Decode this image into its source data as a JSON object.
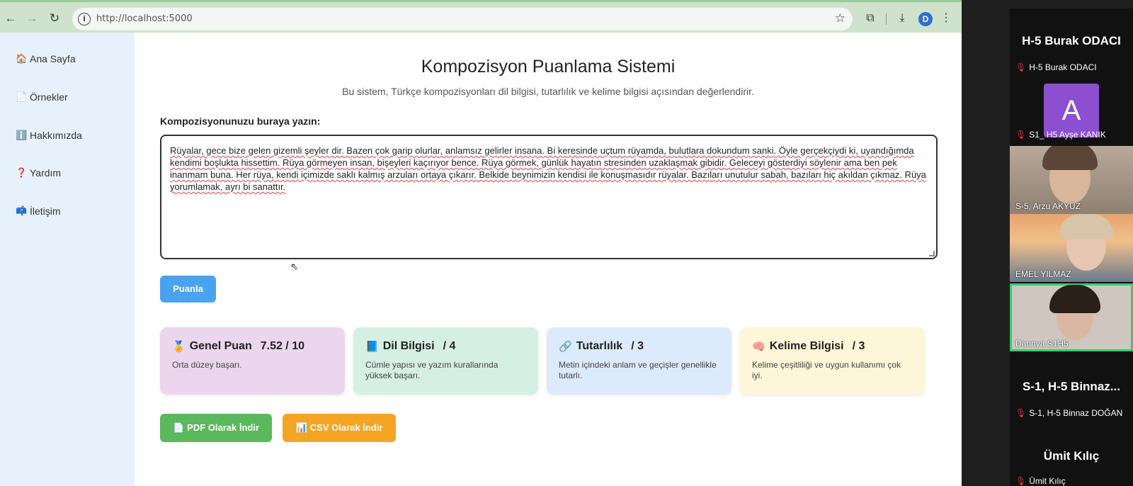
{
  "browser": {
    "url": "http://localhost:5000",
    "profile_initial": "D"
  },
  "sidebar": {
    "items": [
      {
        "icon": "🏠",
        "label": "Ana Sayfa"
      },
      {
        "icon": "📄",
        "label": "Örnekler"
      },
      {
        "icon": "ℹ️",
        "label": "Hakkımızda"
      },
      {
        "icon": "❓",
        "label": "Yardım"
      },
      {
        "icon": "📫",
        "label": "İletişim"
      }
    ]
  },
  "main": {
    "title": "Kompozisyon Puanlama Sistemi",
    "subtitle": "Bu sistem, Türkçe kompozisyonları dil bilgisi, tutarlılık ve kelime bilgisi açısından değerlendirir.",
    "form_label": "Kompozisyonunuzu buraya yazın:",
    "essay": "Rüyalar, gece bize gelen gizemli şeyler dir. Bazen çok garip olurlar, anlamsız gelirler insana. Bi keresinde uçtum rüyamda, bulutlara dokundum sanki. Öyle gerçekçiydi ki, uyandığımda kendimi boşlukta hissettim. Rüya görmeyen insan, bişeyleri kaçırıyor bence. Rüya görmek, günlük hayatın stresinden uzaklaşmak gibidir. Geleceyi gösterdiyi söylenir ama ben pek inanmam buna. Her rüya, kendi içimizde saklı kalmış arzuları ortaya çıkarır. Belkide beynimizin kendisi ile konuşmasıdır rüyalar. Bazıları unutulur sabah, bazıları hiç akıldan çıkmaz. Rüya yorumlamak, ayrı bi sanattır.",
    "score_button": "Puanla",
    "cards": [
      {
        "icon": "🏅",
        "title": "Genel Puan",
        "value": "7.52 / 10",
        "desc": "Orta düzey başarı.",
        "bg": "#ecd6ee"
      },
      {
        "icon": "📘",
        "title": "Dil Bilgisi",
        "value": "/ 4",
        "desc": "Cümle yapısı ve yazım kurallarında yüksek başarı.",
        "bg": "#d5efe5"
      },
      {
        "icon": "🔗",
        "title": "Tutarlılık",
        "value": "/ 3",
        "desc": "Metin içindeki anlam ve geçişler genellikle tutarlı.",
        "bg": "#dcebfb"
      },
      {
        "icon": "🧠",
        "title": "Kelime Bilgisi",
        "value": "/ 3",
        "desc": "Kelime çeşitliliği ve uygun kullanımı çok iyi.",
        "bg": "#fdf6d8"
      }
    ],
    "pdf_button": {
      "icon": "📄",
      "label": "PDF Olarak İndir",
      "color": "#5cb85c"
    },
    "csv_button": {
      "icon": "📊",
      "label": "CSV Olarak İndir",
      "color": "#f5a524"
    }
  },
  "meeting": {
    "participants": [
      {
        "display": "H-5 Burak ODACI",
        "label": "H-5 Burak ODACI",
        "type": "name"
      },
      {
        "display": "A",
        "label": "S1_ H5 Ayşe KANIK",
        "type": "avatar"
      },
      {
        "label": "S-5, Arzu AKYÜZ",
        "type": "video"
      },
      {
        "label": "EMEL YILMAZ",
        "type": "video"
      },
      {
        "label": "Dannya S1H5",
        "type": "video",
        "active": true
      },
      {
        "display": "S-1, H-5 Binnaz...",
        "label": "S-1, H-5 Binnaz DOĞAN",
        "type": "name"
      },
      {
        "display": "Ümit Kılıç",
        "label": "Ümit Kılıç",
        "type": "name"
      }
    ]
  }
}
